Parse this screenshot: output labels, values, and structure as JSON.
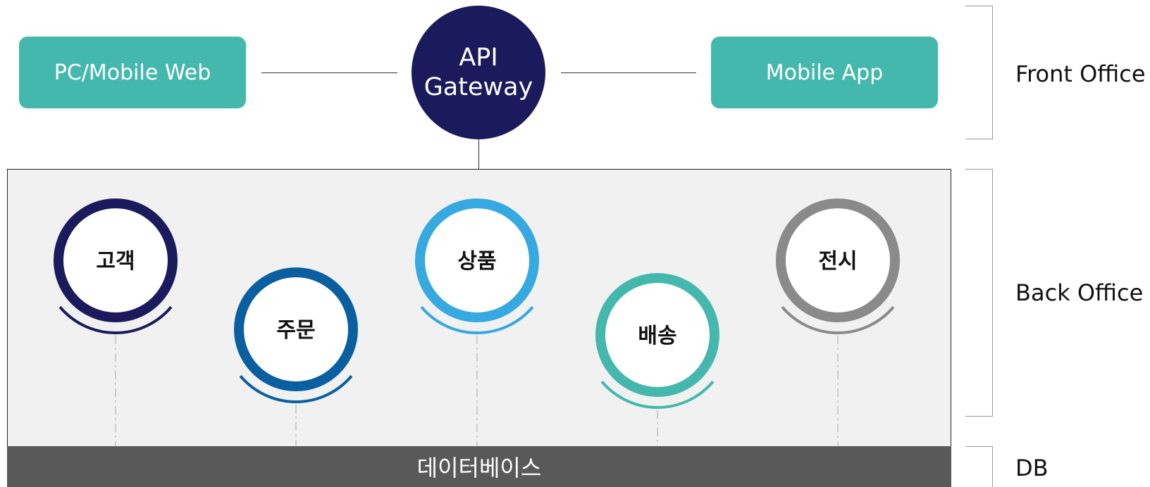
{
  "front": {
    "web_label": "PC/Mobile Web",
    "gateway_line1": "API",
    "gateway_line2": "Gateway",
    "app_label": "Mobile App"
  },
  "tiers": {
    "front_office": "Front Office",
    "back_office": "Back Office",
    "db": "DB"
  },
  "services": [
    {
      "name": "고객",
      "color": "#1b1a5c"
    },
    {
      "name": "주문",
      "color": "#0a5fa0"
    },
    {
      "name": "상품",
      "color": "#35a9e0"
    },
    {
      "name": "배송",
      "color": "#45b8ae"
    },
    {
      "name": "전시",
      "color": "#8a8a8a"
    }
  ],
  "database_label": "데이터베이스",
  "colors": {
    "front_box": "#45b8ae",
    "gateway": "#1b1a5c",
    "panel_bg": "#f1f1f1",
    "db_bar": "#595959"
  }
}
